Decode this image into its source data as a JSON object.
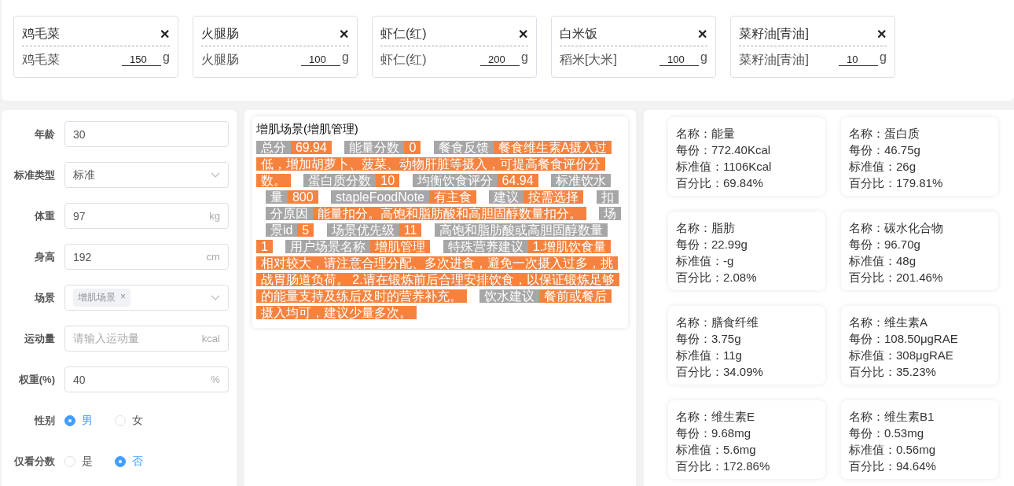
{
  "foods": [
    {
      "title": "鸡毛菜",
      "name": "鸡毛菜",
      "amount": "150",
      "unit": "g"
    },
    {
      "title": "火腿肠",
      "name": "火腿肠",
      "amount": "100",
      "unit": "g"
    },
    {
      "title": "虾仁(红)",
      "name": "虾仁(红)",
      "amount": "200",
      "unit": "g"
    },
    {
      "title": "白米饭",
      "name": "稻米[大米]",
      "amount": "100",
      "unit": "g"
    },
    {
      "title": "菜籽油[青油]",
      "name": "菜籽油[青油]",
      "amount": "10",
      "unit": "g"
    }
  ],
  "close_glyph": "✕",
  "form": [
    {
      "kind": "input",
      "label": "年龄",
      "value": "30"
    },
    {
      "kind": "select",
      "label": "标准类型",
      "value": "标准"
    },
    {
      "kind": "input",
      "label": "体重",
      "value": "97",
      "suffix": "kg"
    },
    {
      "kind": "input",
      "label": "身高",
      "value": "192",
      "suffix": "cm"
    },
    {
      "kind": "tags",
      "label": "场景",
      "tags": [
        {
          "label": "增肌场景",
          "close": "×"
        }
      ]
    },
    {
      "kind": "input",
      "label": "运动量",
      "placeholder": "请输入运动量",
      "suffix": "kcal"
    },
    {
      "kind": "input",
      "label": "权重(%)",
      "value": "40",
      "suffix": "%"
    },
    {
      "kind": "radio",
      "label": "性别",
      "options": [
        {
          "label": "男",
          "selected": true
        },
        {
          "label": "女",
          "selected": false
        }
      ]
    },
    {
      "kind": "radio",
      "label": "仅看分数",
      "options": [
        {
          "label": "是",
          "selected": false
        },
        {
          "label": "否",
          "selected": true
        }
      ]
    }
  ],
  "report": {
    "title": "增肌场景(增肌管理)",
    "pairs": [
      {
        "key": "总分",
        "value": "69.94"
      },
      {
        "key": "能量分数",
        "value": "0"
      },
      {
        "key": "餐食反馈",
        "value": "餐食维生素A摄入过低，增加胡萝卜、菠菜、动物肝脏等摄入，可提高餐食评价分数。"
      },
      {
        "key": "蛋白质分数",
        "value": "10"
      },
      {
        "key": "均衡饮食评分",
        "value": "64.94"
      },
      {
        "key": "标准饮水量",
        "value": "800"
      },
      {
        "key": "stapleFoodNote",
        "value": "有主食"
      },
      {
        "key": "建议",
        "value": "按需选择"
      },
      {
        "key": "扣分原因",
        "value": "能量扣分。高饱和脂肪酸和高胆固醇数量扣分。"
      },
      {
        "key": "场景id",
        "value": "5"
      },
      {
        "key": "场景优先级",
        "value": "11"
      },
      {
        "key": "高饱和脂肪酸或高胆固醇数量",
        "value": "1"
      },
      {
        "key": "用户场景名称",
        "value": "增肌管理"
      },
      {
        "key": "特殊营养建议",
        "value": "1.增肌饮食量相对较大，请注意合理分配、多次进食，避免一次摄入过多，挑战胃肠道负荷。 2.请在锻炼前后合理安排饮食，以保证锻炼足够的能量支持及练后及时的营养补充。"
      },
      {
        "key": "饮水建议",
        "value": "餐前或餐后摄入均可，建议少量多次。"
      }
    ]
  },
  "nutrients": [
    {
      "name": "名称：能量",
      "per": "每份：772.40Kcal",
      "std": "标准值：1106Kcal",
      "pct": "百分比：69.84%"
    },
    {
      "name": "名称：蛋白质",
      "per": "每份：46.75g",
      "std": "标准值：26g",
      "pct": "百分比：179.81%"
    },
    {
      "name": "名称：脂肪",
      "per": "每份：22.99g",
      "std": "标准值：-g",
      "pct": "百分比：2.08%"
    },
    {
      "name": "名称：碳水化合物",
      "per": "每份：96.70g",
      "std": "标准值：48g",
      "pct": "百分比：201.46%"
    },
    {
      "name": "名称：膳食纤维",
      "per": "每份：3.75g",
      "std": "标准值：11g",
      "pct": "百分比：34.09%"
    },
    {
      "name": "名称：维生素A",
      "per": "每份：108.50μgRAE",
      "std": "标准值：308μgRAE",
      "pct": "百分比：35.23%"
    },
    {
      "name": "名称：维生素E",
      "per": "每份：9.68mg",
      "std": "标准值：5.6mg",
      "pct": "百分比：172.86%"
    },
    {
      "name": "名称：维生素B1",
      "per": "每份：0.53mg",
      "std": "标准值：0.56mg",
      "pct": "百分比：94.64%"
    }
  ]
}
